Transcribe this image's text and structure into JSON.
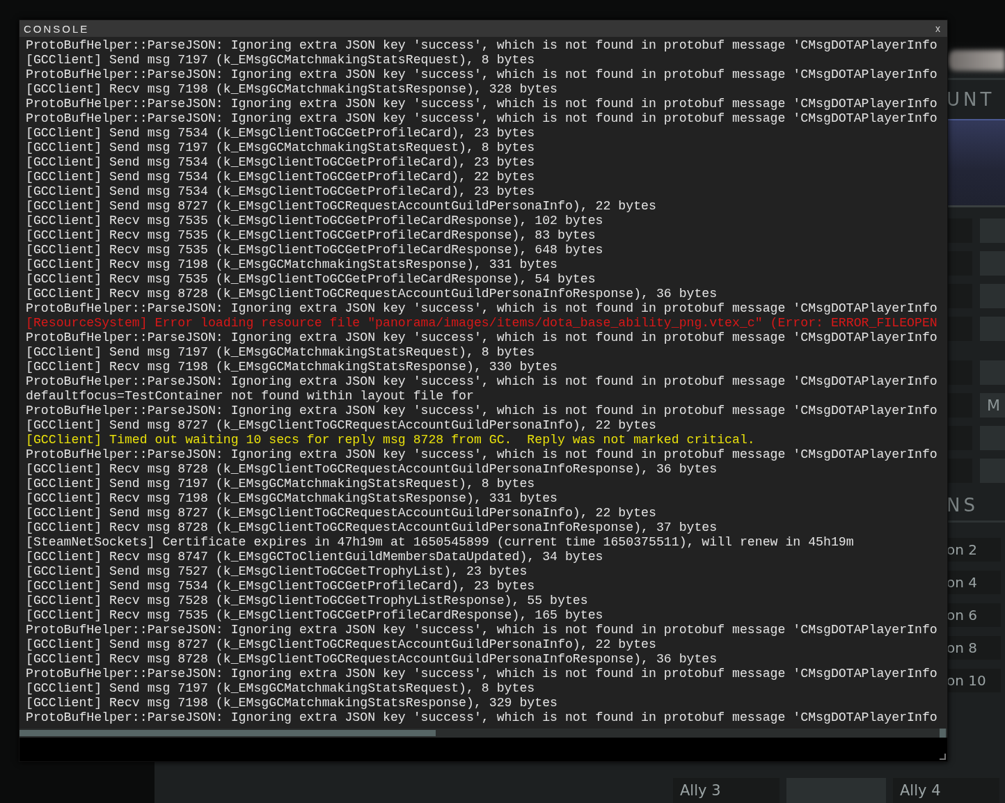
{
  "console": {
    "title": "CONSOLE",
    "close": "x",
    "lines": [
      {
        "kind": "normal",
        "text": "ProtoBufHelper::ParseJSON: Ignoring extra JSON key 'success', which is not found in protobuf message 'CMsgDOTAPlayerInfo"
      },
      {
        "kind": "normal",
        "text": "[GCClient] Send msg 7197 (k_EMsgGCMatchmakingStatsRequest), 8 bytes"
      },
      {
        "kind": "normal",
        "text": "ProtoBufHelper::ParseJSON: Ignoring extra JSON key 'success', which is not found in protobuf message 'CMsgDOTAPlayerInfo"
      },
      {
        "kind": "normal",
        "text": "[GCClient] Recv msg 7198 (k_EMsgGCMatchmakingStatsResponse), 328 bytes"
      },
      {
        "kind": "normal",
        "text": "ProtoBufHelper::ParseJSON: Ignoring extra JSON key 'success', which is not found in protobuf message 'CMsgDOTAPlayerInfo"
      },
      {
        "kind": "normal",
        "text": "ProtoBufHelper::ParseJSON: Ignoring extra JSON key 'success', which is not found in protobuf message 'CMsgDOTAPlayerInfo"
      },
      {
        "kind": "normal",
        "text": "[GCClient] Send msg 7534 (k_EMsgClientToGCGetProfileCard), 23 bytes"
      },
      {
        "kind": "normal",
        "text": "[GCClient] Send msg 7197 (k_EMsgGCMatchmakingStatsRequest), 8 bytes"
      },
      {
        "kind": "normal",
        "text": "[GCClient] Send msg 7534 (k_EMsgClientToGCGetProfileCard), 23 bytes"
      },
      {
        "kind": "normal",
        "text": "[GCClient] Send msg 7534 (k_EMsgClientToGCGetProfileCard), 22 bytes"
      },
      {
        "kind": "normal",
        "text": "[GCClient] Send msg 7534 (k_EMsgClientToGCGetProfileCard), 23 bytes"
      },
      {
        "kind": "normal",
        "text": "[GCClient] Send msg 8727 (k_EMsgClientToGCRequestAccountGuildPersonaInfo), 22 bytes"
      },
      {
        "kind": "normal",
        "text": "[GCClient] Recv msg 7535 (k_EMsgClientToGCGetProfileCardResponse), 102 bytes"
      },
      {
        "kind": "normal",
        "text": "[GCClient] Recv msg 7535 (k_EMsgClientToGCGetProfileCardResponse), 83 bytes"
      },
      {
        "kind": "normal",
        "text": "[GCClient] Recv msg 7535 (k_EMsgClientToGCGetProfileCardResponse), 648 bytes"
      },
      {
        "kind": "normal",
        "text": "[GCClient] Recv msg 7198 (k_EMsgGCMatchmakingStatsResponse), 331 bytes"
      },
      {
        "kind": "normal",
        "text": "[GCClient] Recv msg 7535 (k_EMsgClientToGCGetProfileCardResponse), 54 bytes"
      },
      {
        "kind": "normal",
        "text": "[GCClient] Recv msg 8728 (k_EMsgClientToGCRequestAccountGuildPersonaInfoResponse), 36 bytes"
      },
      {
        "kind": "normal",
        "text": "ProtoBufHelper::ParseJSON: Ignoring extra JSON key 'success', which is not found in protobuf message 'CMsgDOTAPlayerInfo"
      },
      {
        "kind": "error",
        "text": "[ResourceSystem] Error loading resource file \"panorama/images/items/dota_base_ability_png.vtex_c\" (Error: ERROR_FILEOPEN"
      },
      {
        "kind": "normal",
        "text": "ProtoBufHelper::ParseJSON: Ignoring extra JSON key 'success', which is not found in protobuf message 'CMsgDOTAPlayerInfo"
      },
      {
        "kind": "normal",
        "text": "[GCClient] Send msg 7197 (k_EMsgGCMatchmakingStatsRequest), 8 bytes"
      },
      {
        "kind": "normal",
        "text": "[GCClient] Recv msg 7198 (k_EMsgGCMatchmakingStatsResponse), 330 bytes"
      },
      {
        "kind": "normal",
        "text": "ProtoBufHelper::ParseJSON: Ignoring extra JSON key 'success', which is not found in protobuf message 'CMsgDOTAPlayerInfo"
      },
      {
        "kind": "normal",
        "text": "defaultfocus=TestContainer not found within layout file for"
      },
      {
        "kind": "normal",
        "text": "ProtoBufHelper::ParseJSON: Ignoring extra JSON key 'success', which is not found in protobuf message 'CMsgDOTAPlayerInfo"
      },
      {
        "kind": "normal",
        "text": "[GCClient] Send msg 8727 (k_EMsgClientToGCRequestAccountGuildPersonaInfo), 22 bytes"
      },
      {
        "kind": "warning",
        "text": "[GCClient] Timed out waiting 10 secs for reply msg 8728 from GC.  Reply was not marked critical."
      },
      {
        "kind": "normal",
        "text": "ProtoBufHelper::ParseJSON: Ignoring extra JSON key 'success', which is not found in protobuf message 'CMsgDOTAPlayerInfo"
      },
      {
        "kind": "normal",
        "text": "[GCClient] Recv msg 8728 (k_EMsgClientToGCRequestAccountGuildPersonaInfoResponse), 36 bytes"
      },
      {
        "kind": "normal",
        "text": "[GCClient] Send msg 7197 (k_EMsgGCMatchmakingStatsRequest), 8 bytes"
      },
      {
        "kind": "normal",
        "text": "[GCClient] Recv msg 7198 (k_EMsgGCMatchmakingStatsResponse), 331 bytes"
      },
      {
        "kind": "normal",
        "text": "[GCClient] Send msg 8727 (k_EMsgClientToGCRequestAccountGuildPersonaInfo), 22 bytes"
      },
      {
        "kind": "normal",
        "text": "[GCClient] Recv msg 8728 (k_EMsgClientToGCRequestAccountGuildPersonaInfoResponse), 37 bytes"
      },
      {
        "kind": "normal",
        "text": "[SteamNetSockets] Certificate expires in 47h19m at 1650545899 (current time 1650375511), will renew in 45h19m"
      },
      {
        "kind": "normal",
        "text": "[GCClient] Recv msg 8747 (k_EMsgGCToClientGuildMembersDataUpdated), 34 bytes"
      },
      {
        "kind": "normal",
        "text": "[GCClient] Send msg 7527 (k_EMsgClientToGCGetTrophyList), 23 bytes"
      },
      {
        "kind": "normal",
        "text": "[GCClient] Send msg 7534 (k_EMsgClientToGCGetProfileCard), 23 bytes"
      },
      {
        "kind": "normal",
        "text": "[GCClient] Recv msg 7528 (k_EMsgClientToGCGetTrophyListResponse), 55 bytes"
      },
      {
        "kind": "normal",
        "text": "[GCClient] Recv msg 7535 (k_EMsgClientToGCGetProfileCardResponse), 165 bytes"
      },
      {
        "kind": "normal",
        "text": "ProtoBufHelper::ParseJSON: Ignoring extra JSON key 'success', which is not found in protobuf message 'CMsgDOTAPlayerInfo"
      },
      {
        "kind": "normal",
        "text": "[GCClient] Send msg 8727 (k_EMsgClientToGCRequestAccountGuildPersonaInfo), 22 bytes"
      },
      {
        "kind": "normal",
        "text": "[GCClient] Recv msg 8728 (k_EMsgClientToGCRequestAccountGuildPersonaInfoResponse), 36 bytes"
      },
      {
        "kind": "normal",
        "text": "ProtoBufHelper::ParseJSON: Ignoring extra JSON key 'success', which is not found in protobuf message 'CMsgDOTAPlayerInfo"
      },
      {
        "kind": "normal",
        "text": "[GCClient] Send msg 7197 (k_EMsgGCMatchmakingStatsRequest), 8 bytes"
      },
      {
        "kind": "normal",
        "text": "[GCClient] Recv msg 7198 (k_EMsgGCMatchmakingStatsResponse), 329 bytes"
      },
      {
        "kind": "normal",
        "text": "ProtoBufHelper::ParseJSON: Ignoring extra JSON key 'success', which is not found in protobuf message 'CMsgDOTAPlayerInfo"
      }
    ]
  },
  "background": {
    "heading_1": "UNT",
    "tile_label": "M",
    "heading_2": "NS",
    "option_tiles": [
      "on 2",
      "on 4",
      "on 6",
      "on 8",
      "on 10"
    ],
    "ally_tiles": [
      "Ally 3",
      "Ally 4"
    ]
  }
}
